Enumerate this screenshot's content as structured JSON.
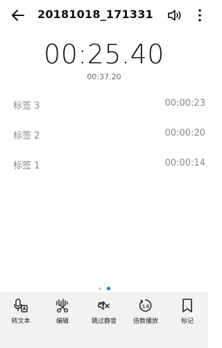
{
  "header": {
    "title": "20181018_171331",
    "back_icon": "arrow-left-icon",
    "speaker_icon": "speaker-icon",
    "more_icon": "more-vertical-icon"
  },
  "player": {
    "current_time": "00:25.40",
    "total_time": "00:37.20"
  },
  "marks": [
    {
      "label": "标签 3",
      "time": "00:00:23"
    },
    {
      "label": "标签 2",
      "time": "00:00:20"
    },
    {
      "label": "标签 1",
      "time": "00:00:14"
    }
  ],
  "pager": {
    "pages": 2,
    "active": 2,
    "active_color": "#1877e8"
  },
  "toolbar": {
    "items": [
      {
        "label": "转文本",
        "icon": "speech-to-text-icon"
      },
      {
        "label": "编辑",
        "icon": "edit-waveform-icon"
      },
      {
        "label": "跳过静音",
        "icon": "skip-silence-icon"
      },
      {
        "label": "倍数播放",
        "icon": "playback-speed-icon"
      },
      {
        "label": "标记",
        "icon": "bookmark-icon"
      }
    ]
  }
}
